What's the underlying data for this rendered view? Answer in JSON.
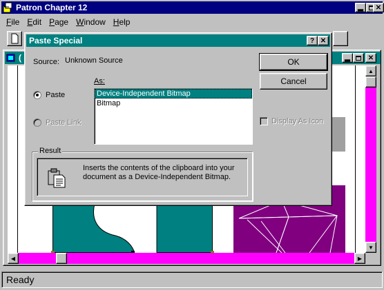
{
  "app": {
    "title": "Patron Chapter 12",
    "menu": [
      {
        "key": "F",
        "rest": "ile"
      },
      {
        "key": "E",
        "rest": "dit"
      },
      {
        "key": "P",
        "rest": "age"
      },
      {
        "key": "W",
        "rest": "indow"
      },
      {
        "key": "H",
        "rest": "elp"
      }
    ],
    "child_title": "(",
    "status": "Ready"
  },
  "dialog": {
    "title": "Paste Special",
    "source_label": "Source:",
    "source_value": "Unknown Source",
    "as_label": "As:",
    "options": {
      "paste": "Paste",
      "paste_link": "Paste Link"
    },
    "as_items": [
      "Device-Independent Bitmap",
      "Bitmap"
    ],
    "selected_as": "Device-Independent Bitmap",
    "ok": "OK",
    "cancel": "Cancel",
    "display_as_icon": "Display As Icon",
    "result_label": "Result",
    "result_text": "Inserts the contents of the clipboard into your document as a Device-Independent Bitmap."
  },
  "colors": {
    "title_active": "#000080",
    "title_dialog": "#008080",
    "selection": "#008080",
    "scrollbar_track": "#ff00ff",
    "shape_teal": "#008080",
    "shape_purple": "#800080"
  }
}
